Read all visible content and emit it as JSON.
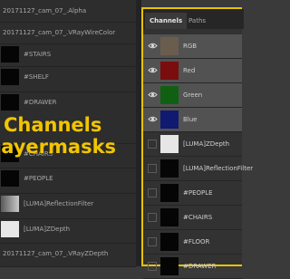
{
  "layers": [
    {
      "name": "20171127_cam_07_.Alpha",
      "thumb": "none"
    },
    {
      "name": "20171127_cam_07_.VRayWireColor",
      "thumb": "none"
    },
    {
      "name": "#STAIRS",
      "thumb": "black"
    },
    {
      "name": "#SHELF",
      "thumb": "black"
    },
    {
      "name": "#DRAWER",
      "thumb": "black"
    },
    {
      "name": "#CHAIRS",
      "thumb": "black"
    },
    {
      "name": "#PEOPLE",
      "thumb": "black"
    },
    {
      "name": "[LUMA]ReflectionFilter",
      "thumb": "gray"
    },
    {
      "name": "[LUMA]ZDepth",
      "thumb": "white"
    },
    {
      "name": "20171127_cam_07_.VRayZDepth",
      "thumb": "none"
    }
  ],
  "overlay": {
    "line1": "Channels",
    "line2": "layermasks"
  },
  "channels_panel": {
    "tabs": [
      "Channels",
      "Paths"
    ],
    "active_tab": "Channels",
    "rows": [
      {
        "label": "RGB",
        "visible": true,
        "thumb_color": "#6b5d4e"
      },
      {
        "label": "Red",
        "visible": true,
        "thumb_color": "#7a0d0d"
      },
      {
        "label": "Green",
        "visible": true,
        "thumb_color": "#0f6012"
      },
      {
        "label": "Blue",
        "visible": true,
        "thumb_color": "#101a70"
      },
      {
        "label": "[LUMA]ZDepth",
        "visible": false,
        "thumb_color": "#e6e6e6"
      },
      {
        "label": "[LUMA]ReflectionFilter",
        "visible": false,
        "thumb_color": "#060606"
      },
      {
        "label": "#PEOPLE",
        "visible": false,
        "thumb_color": "#050505"
      },
      {
        "label": "#CHAIRS",
        "visible": false,
        "thumb_color": "#050505"
      },
      {
        "label": "#FLOOR",
        "visible": false,
        "thumb_color": "#050505"
      },
      {
        "label": "#DRAWER",
        "visible": false,
        "thumb_color": "#050505"
      }
    ]
  },
  "colors": {
    "highlight_border": "#e8c300",
    "overlay_text": "#f2c500"
  }
}
